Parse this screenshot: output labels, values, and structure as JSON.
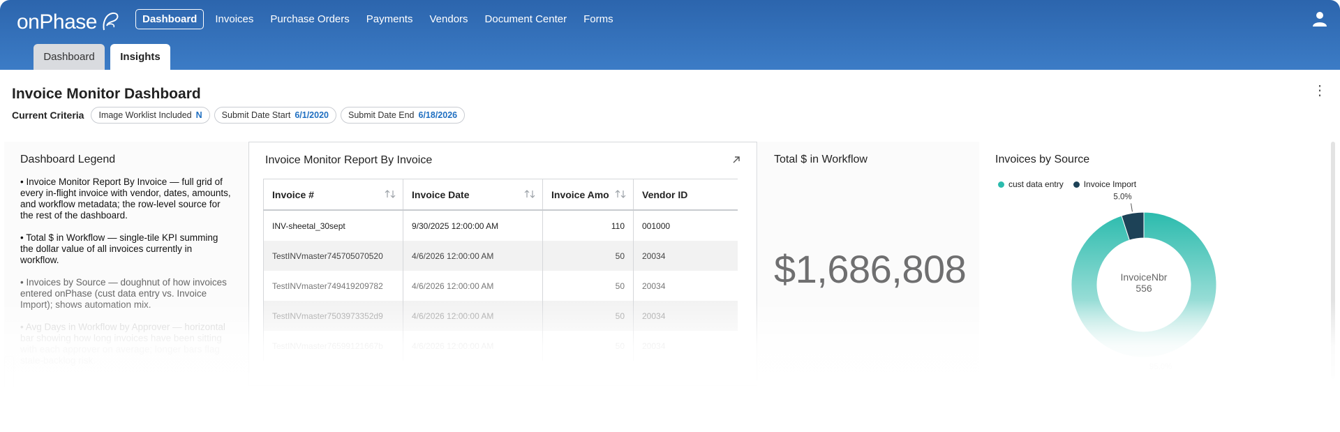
{
  "app": {
    "logo": "onPhase"
  },
  "nav": {
    "items": [
      "Dashboard",
      "Invoices",
      "Purchase Orders",
      "Payments",
      "Vendors",
      "Document Center",
      "Forms"
    ]
  },
  "subtabs": [
    "Dashboard",
    "Insights"
  ],
  "page": {
    "title": "Invoice Monitor Dashboard"
  },
  "criteria": {
    "label": "Current Criteria",
    "chips": [
      {
        "label": "Image Worklist Included",
        "value": "N"
      },
      {
        "label": "Submit Date Start",
        "value": "6/1/2020"
      },
      {
        "label": "Submit Date End",
        "value": "6/18/2026"
      }
    ]
  },
  "legend": {
    "title": "Dashboard Legend",
    "items": [
      "• Invoice Monitor Report By Invoice — full grid of every in-flight invoice with vendor, dates, amounts, and workflow metadata; the row-level source for the rest of the dashboard.",
      "• Total $ in Workflow — single-tile KPI summing the dollar value of all invoices currently in workflow.",
      "• Invoices by Source — doughnut of how invoices entered onPhase (cust data entry vs. Invoice Import); shows automation mix.",
      "• Avg Days in Workflow by Approver — horizontal bar showing how long invoices have been sitting with each approver on average; longer bars flag stale-backlog risk."
    ]
  },
  "report": {
    "title": "Invoice Monitor Report By Invoice",
    "columns": [
      "Invoice #",
      "Invoice Date",
      "Invoice Amo",
      "Vendor ID"
    ],
    "rows": [
      [
        "INV-sheetal_30sept",
        "9/30/2025 12:00:00 AM",
        "110",
        "001000"
      ],
      [
        "TestINVmaster745705070520",
        "4/6/2026 12:00:00 AM",
        "50",
        "20034"
      ],
      [
        "TestINVmaster749419209782",
        "4/6/2026 12:00:00 AM",
        "50",
        "20034"
      ],
      [
        "TestINVmaster7503973352d9",
        "4/6/2026 12:00:00 AM",
        "50",
        "20034"
      ],
      [
        "TestINVmaster76599121667b",
        "4/6/2026 12:00:00 AM",
        "50",
        "20034"
      ]
    ]
  },
  "kpi": {
    "title": "Total $ in Workflow",
    "value": "$1,686,808"
  },
  "source": {
    "title": "Invoices by Source",
    "center_label": "InvoiceNbr",
    "center_value": "556"
  },
  "colors": {
    "nav_top": "#2c65ad",
    "accent_blue": "#1f6fc1",
    "teal": "#2bbbad",
    "dark_slate": "#1d4257"
  },
  "chart_data": {
    "type": "pie",
    "title": "Invoices by Source",
    "categories": [
      "cust data entry",
      "Invoice Import"
    ],
    "values": [
      95.0,
      5.0
    ],
    "labels": [
      "95.0%",
      "5.0%"
    ],
    "colors": [
      "#2bbbad",
      "#1d4257"
    ],
    "legend": "top-left",
    "donut": true
  }
}
